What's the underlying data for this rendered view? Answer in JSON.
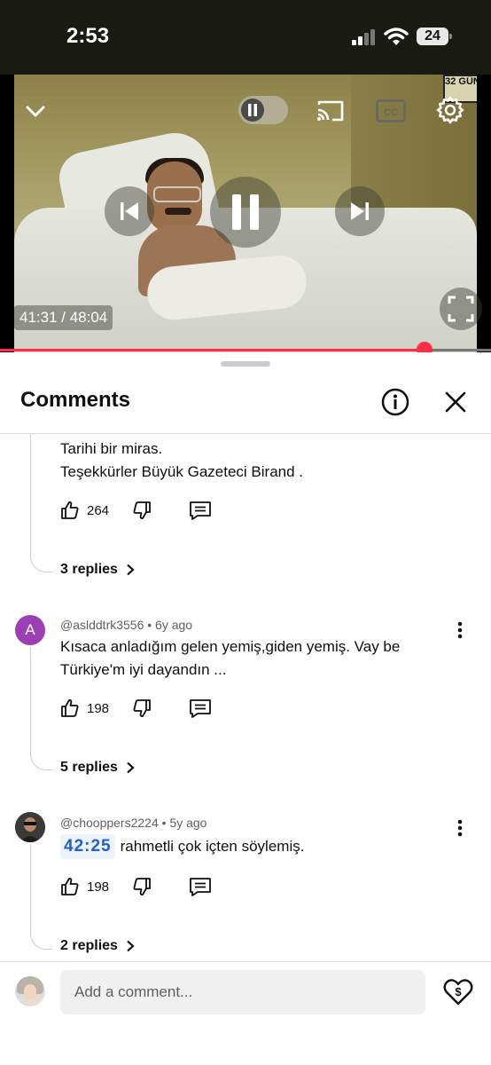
{
  "status_bar": {
    "time": "2:53",
    "battery": "24"
  },
  "player": {
    "logo_text": "32 GÜN",
    "timecode": "41:31 / 48:04",
    "progress_percent": 86.4,
    "cc_label": "CC"
  },
  "comments_panel": {
    "title": "Comments",
    "comments": [
      {
        "text_lines": [
          "Tarihi bir miras.",
          "Teşekkürler Büyük Gazeteci Birand ."
        ],
        "likes": "264",
        "replies": "3 replies"
      },
      {
        "avatar_letter": "A",
        "avatar_color": "#9c3fb5",
        "meta": "@aslddtrk3556 • 6y ago",
        "text_lines": [
          "Kısaca anladığım gelen yemiş,giden yemiş. Vay be",
          "Türkiye'm iyi dayandın ..."
        ],
        "likes": "198",
        "replies": "5 replies"
      },
      {
        "meta": "@chooppers2224 • 5y ago",
        "timestamp": "42:25",
        "text": "rahmetli çok içten söylemiş.",
        "likes": "198",
        "replies": "2 replies"
      }
    ],
    "composer": {
      "placeholder": "Add a comment..."
    }
  },
  "colors": {
    "accent": "#ff2d48",
    "link": "#2160c4"
  }
}
